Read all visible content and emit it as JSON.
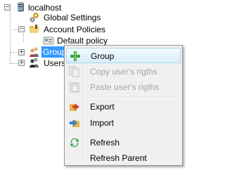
{
  "tree": {
    "root": {
      "label": "localhost",
      "icon": "server-icon",
      "expander": "−"
    },
    "global_settings": {
      "label": "Global Settings",
      "icon": "gears-icon"
    },
    "account_policies": {
      "label": "Account Policies",
      "icon": "folder-icon",
      "expander": "−"
    },
    "default_policy": {
      "label": "Default policy",
      "icon": "policy-card-icon"
    },
    "groups": {
      "label": "Group",
      "icon": "group-icon",
      "expander": "+"
    },
    "users": {
      "label": "Users",
      "icon": "users-icon",
      "expander": "+"
    }
  },
  "context_menu": {
    "items": [
      {
        "label": "Group",
        "icon": "add-icon",
        "enabled": true,
        "highlighted": true
      },
      {
        "label": "Copy user's rigths",
        "icon": "copy-icon",
        "enabled": false
      },
      {
        "label": "Paste user's rigths",
        "icon": "paste-icon",
        "enabled": false
      },
      {
        "label": "Export",
        "icon": "export-icon",
        "enabled": true
      },
      {
        "label": "Import",
        "icon": "import-icon",
        "enabled": true
      },
      {
        "label": "Refresh",
        "icon": "refresh-icon",
        "enabled": true
      },
      {
        "label": "Refresh Parent",
        "icon": "",
        "enabled": true
      }
    ]
  },
  "colors": {
    "selection": "#3399ff",
    "menu_background": "#f0f0f0",
    "menu_highlight_border": "#a8d8eb",
    "disabled_text": "#a5a5a5"
  }
}
